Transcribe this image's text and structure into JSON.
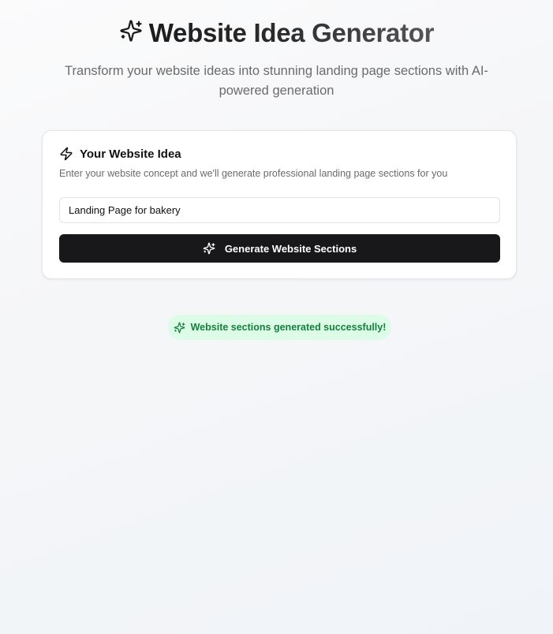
{
  "header": {
    "icon": "sparkles-icon",
    "title": "Website Idea Generator",
    "subtitle": "Transform your website ideas into stunning landing page sections with AI-powered generation"
  },
  "card": {
    "icon": "zap-icon",
    "title": "Your Website Idea",
    "description": "Enter your website concept and we'll generate professional landing page sections for you",
    "input": {
      "value": "Landing Page for bakery",
      "placeholder": ""
    },
    "button": {
      "icon": "sparkles-icon",
      "label": "Generate Website Sections"
    }
  },
  "status": {
    "icon": "sparkles-icon",
    "message": "Website sections generated successfully!"
  },
  "colors": {
    "button_bg": "#18181b",
    "success_bg": "#dcfce7",
    "success_text": "#15803d"
  }
}
